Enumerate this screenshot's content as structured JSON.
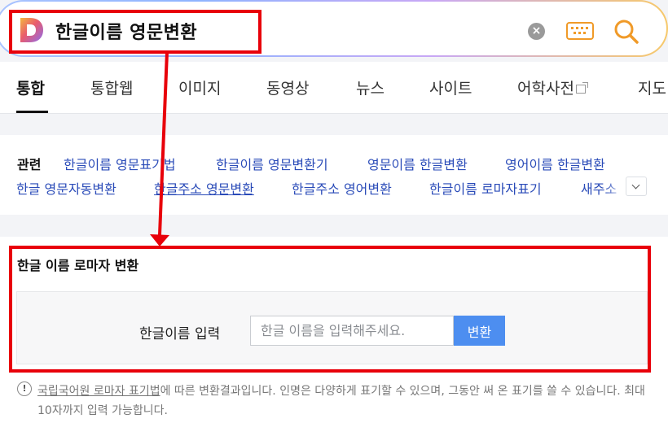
{
  "search": {
    "query": "한글이름 영문변환",
    "clear_glyph": "×",
    "logo_letter": "D",
    "accent_color": "#f09a28"
  },
  "tabs": [
    {
      "label": "통합",
      "active": true
    },
    {
      "label": "통합웹"
    },
    {
      "label": "이미지"
    },
    {
      "label": "동영상"
    },
    {
      "label": "뉴스"
    },
    {
      "label": "사이트"
    },
    {
      "label": "어학사전",
      "external": true
    },
    {
      "label": "지도"
    }
  ],
  "related": {
    "label": "관련",
    "row1": [
      "한글이름 영문표기법",
      "한글이름 영문변환기",
      "영문이름 한글변환",
      "영어이름 한글변환"
    ],
    "row2": [
      "한글 영문자동변환",
      "한글주소 영문변환",
      "한글주소 영어변환",
      "한글이름 로마자표기",
      "새주소"
    ]
  },
  "converter": {
    "title": "한글 이름 로마자 변환",
    "input_label": "한글이름 입력",
    "input_placeholder": "한글 이름을 입력해주세요.",
    "input_value": "",
    "button_label": "변환",
    "notice_icon": "!",
    "notice_link": "국립국어원 로마자 표기법",
    "notice_text": "에 따른 변환결과입니다. 인명은 다양하게 표기할 수 있으며, 그동안 써 온 표기를 쓸 수 있습니다. 최대 10자까지 입력 가능합니다."
  },
  "annotation": {
    "color": "#e8000a"
  }
}
